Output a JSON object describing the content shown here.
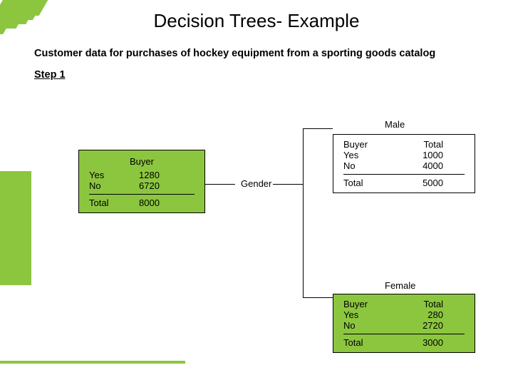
{
  "title": "Decision Trees- Example",
  "subtitle": "Customer data for purchases of hockey equipment from a sporting goods catalog",
  "step": "Step 1",
  "gender_label": "Gender",
  "male_label": "Male",
  "female_label": "Female",
  "col_buyer": "Buyer",
  "col_total": "Total",
  "row_yes": "Yes",
  "row_no": "No",
  "row_total": "Total",
  "all": {
    "yes": "1280",
    "no": "6720",
    "total": "8000"
  },
  "male": {
    "yes": "1000",
    "no": "4000",
    "total": "5000"
  },
  "female": {
    "yes": "280",
    "no": "2720",
    "total": "3000"
  },
  "chart_data": {
    "type": "table",
    "title": "Decision tree split on Gender for hockey equipment buyers",
    "root": {
      "split_variable": "Gender",
      "rows": [
        {
          "buyer": "Yes",
          "count": 1280
        },
        {
          "buyer": "No",
          "count": 6720
        },
        {
          "buyer": "Total",
          "count": 8000
        }
      ]
    },
    "branches": [
      {
        "value": "Male",
        "rows": [
          {
            "buyer": "Yes",
            "count": 1000
          },
          {
            "buyer": "No",
            "count": 4000
          },
          {
            "buyer": "Total",
            "count": 5000
          }
        ]
      },
      {
        "value": "Female",
        "rows": [
          {
            "buyer": "Yes",
            "count": 280
          },
          {
            "buyer": "No",
            "count": 2720
          },
          {
            "buyer": "Total",
            "count": 3000
          }
        ]
      }
    ]
  }
}
